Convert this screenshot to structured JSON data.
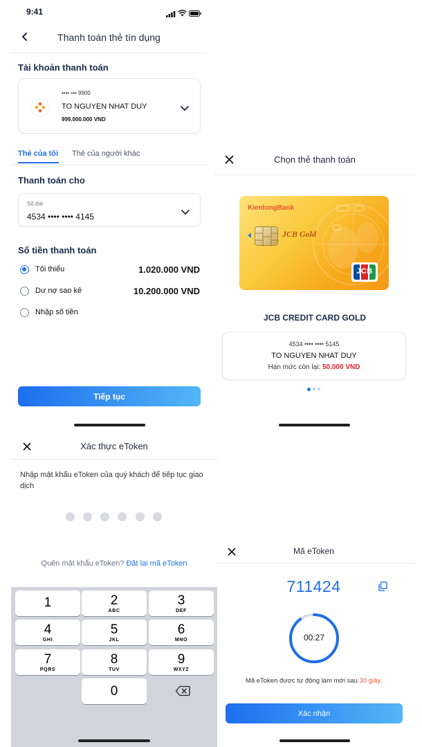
{
  "status_bar": {
    "time": "9:41"
  },
  "payment_screen": {
    "title": "Thanh toán thẻ tín dụng",
    "account_section_title": "Tài khoản thanh toán",
    "account": {
      "masked_number": "•••• ••• 9900",
      "holder": "TO NGUYEN NHAT DUY",
      "balance": "999.000.000 VND"
    },
    "tabs": [
      "Thẻ của tôi",
      "Thẻ của người khác"
    ],
    "pay_for_title": "Thanh toán cho",
    "card_field": {
      "label": "Số thẻ",
      "value": "4534 •••• •••• 4145"
    },
    "amount_title": "Số tiền thanh toán",
    "options": [
      {
        "label": "Tối thiểu",
        "amount": "1.020.000 VND",
        "selected": true
      },
      {
        "label": "Dư nợ sao kê",
        "amount": "10.200.000 VND",
        "selected": false
      },
      {
        "label": "Nhập số tiền",
        "amount": "",
        "selected": false
      }
    ],
    "continue_label": "Tiếp tục"
  },
  "choose_card_screen": {
    "title": "Chọn thẻ thanh toán",
    "card_visual": {
      "bank_logo": "KienlongBank",
      "product": "JCB Gold",
      "network": "JCB"
    },
    "card_name": "JCB CREDIT CARD GOLD",
    "card_number": "4534 •••• •••• 5145",
    "holder": "TO NGUYEN NHAT DUY",
    "limit_label": "Hạn mức còn lại:",
    "limit_value": "50.000 VND",
    "pager": {
      "count": 3,
      "active": 0
    }
  },
  "etoken_verify_screen": {
    "title": "Xác thực eToken",
    "instruction": "Nhập mật khẩu eToken của quý khách để tiếp tục giao dịch",
    "pin_length": 6,
    "forgot_text": "Quên mật khẩu eToken?",
    "reset_link": "Đặt lại mã eToken",
    "keypad": [
      {
        "num": "1",
        "letters": ""
      },
      {
        "num": "2",
        "letters": "ABC"
      },
      {
        "num": "3",
        "letters": "DEF"
      },
      {
        "num": "4",
        "letters": "GHI"
      },
      {
        "num": "5",
        "letters": "JKL"
      },
      {
        "num": "6",
        "letters": "MNO"
      },
      {
        "num": "7",
        "letters": "PQRS"
      },
      {
        "num": "8",
        "letters": "TUV"
      },
      {
        "num": "9",
        "letters": "WXYZ"
      },
      {
        "num": "0",
        "letters": ""
      }
    ]
  },
  "etoken_code_screen": {
    "title": "Mã eToken",
    "code": "711424",
    "countdown": "00:27",
    "countdown_progress": 0.9,
    "refresh_text": "Mã eToken được tự động làm mới sau",
    "refresh_seconds": "30 giây.",
    "confirm_label": "Xác nhận"
  },
  "colors": {
    "accent": "#1f6fe8",
    "navy": "#1b2b4b",
    "red": "#e0202c",
    "orange": "#f0572b"
  },
  "icons": [
    "back-arrow-icon",
    "close-icon",
    "chevron-down-icon",
    "copy-icon",
    "backspace-icon",
    "bank-logo-icon",
    "signal-icon",
    "wifi-icon",
    "battery-icon"
  ]
}
